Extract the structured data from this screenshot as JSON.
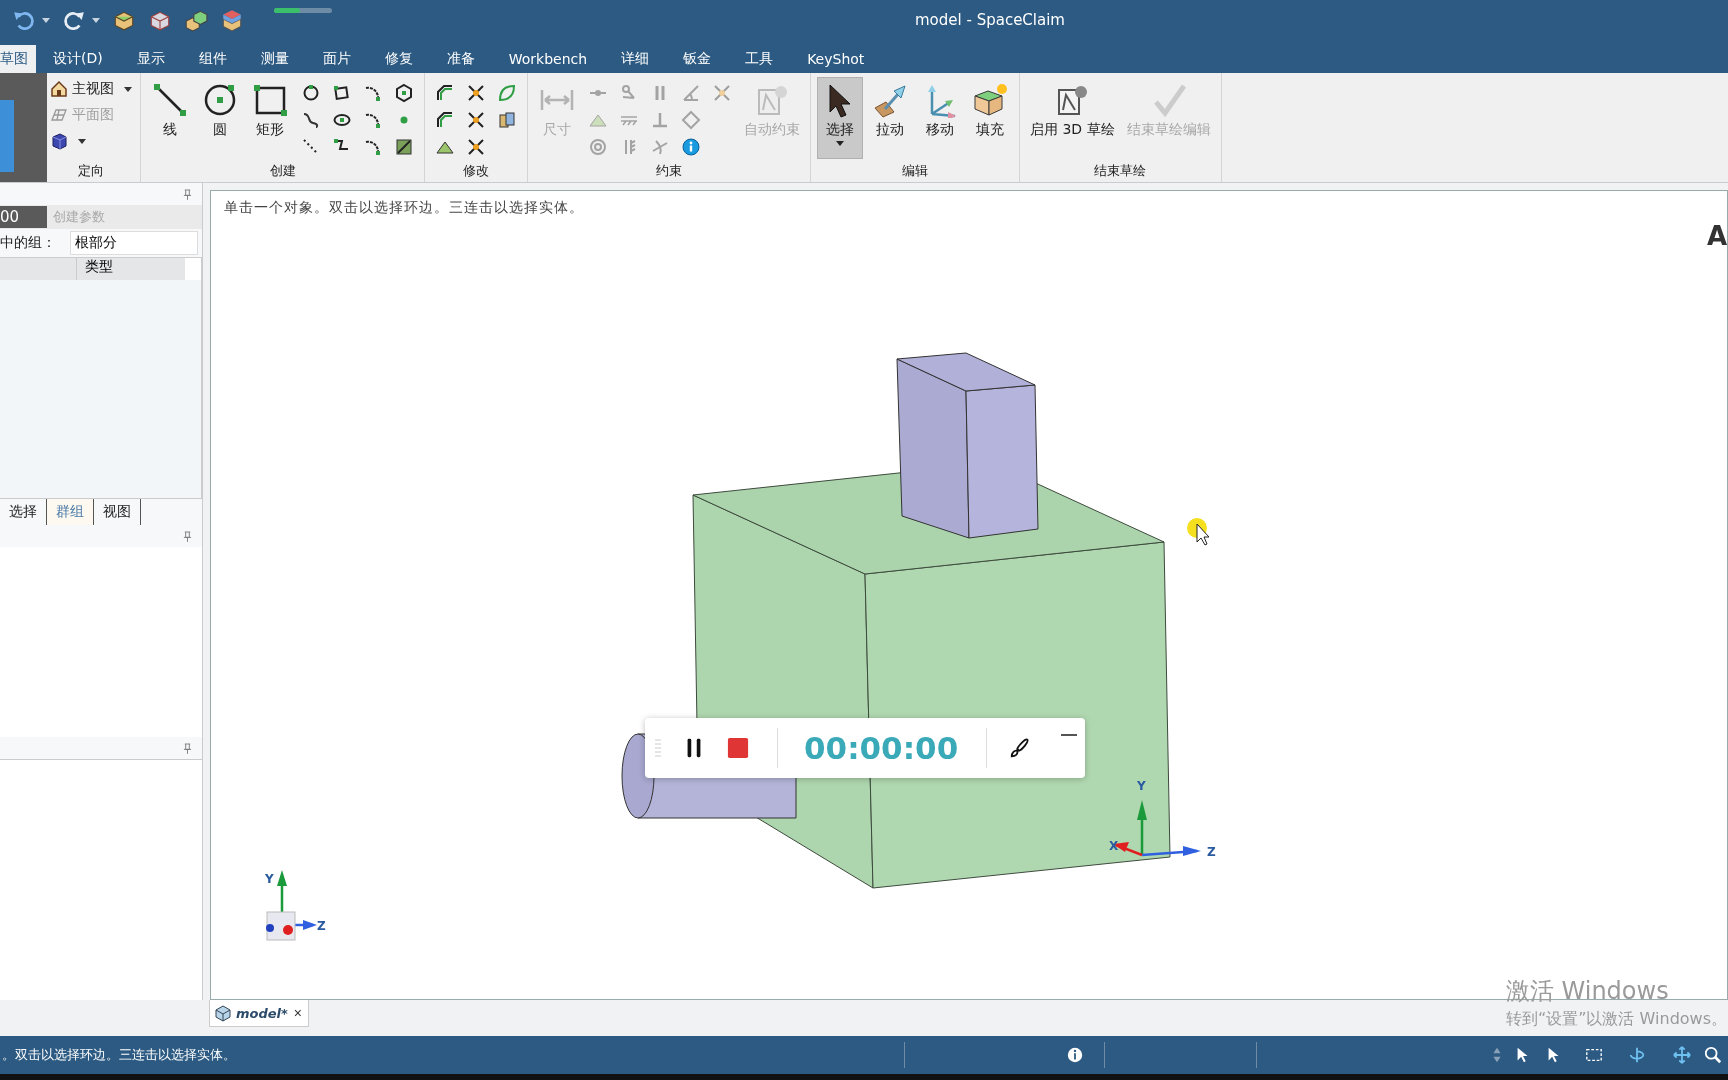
{
  "window": {
    "title": "model - SpaceClaim"
  },
  "quick_access": [
    {
      "kind": "undo",
      "dropdown": true
    },
    {
      "kind": "redo",
      "dropdown": true
    },
    {
      "kind": "box"
    },
    {
      "kind": "box-frame"
    },
    {
      "kind": "boxes"
    },
    {
      "kind": "stack"
    }
  ],
  "progress": {
    "level": 0.45
  },
  "ribbon_tabs": [
    {
      "label": "草图",
      "selected": true
    },
    {
      "label": "设计(D)",
      "selected": false
    },
    {
      "label": "显示",
      "selected": false
    },
    {
      "label": "组件",
      "selected": false
    },
    {
      "label": "测量",
      "selected": false
    },
    {
      "label": "面片",
      "selected": false
    },
    {
      "label": "修复",
      "selected": false
    },
    {
      "label": "准备",
      "selected": false
    },
    {
      "label": "Workbench",
      "selected": false
    },
    {
      "label": "详细",
      "selected": false
    },
    {
      "label": "钣金",
      "selected": false
    },
    {
      "label": "工具",
      "selected": false
    },
    {
      "label": "KeyShot",
      "selected": false
    }
  ],
  "ribbon_groups": [
    {
      "label": "定向",
      "rows": [
        {
          "kind": "home",
          "label": "主视图",
          "dropdown": true,
          "disabled": false
        },
        {
          "kind": "grid",
          "label": "平面图",
          "disabled": true
        },
        {
          "kind": "cube",
          "dropdown": true,
          "disabled": false
        }
      ]
    },
    {
      "label": "创建",
      "large": [
        {
          "kind": "line",
          "label": "线",
          "disabled": false,
          "selected": false
        },
        {
          "kind": "circle",
          "label": "圆",
          "disabled": false,
          "selected": false
        },
        {
          "kind": "rect",
          "label": "矩形",
          "disabled": false,
          "selected": false
        }
      ],
      "tools": [
        {
          "kind": "ring",
          "disabled": false
        },
        {
          "kind": "curve",
          "disabled": false
        },
        {
          "kind": "dotted",
          "disabled": false
        },
        {
          "kind": "square",
          "disabled": false
        },
        {
          "kind": "ellipse",
          "disabled": false
        },
        {
          "kind": "zigzag",
          "disabled": false
        },
        {
          "kind": "arc",
          "disabled": false
        },
        {
          "kind": "arc",
          "disabled": false
        },
        {
          "kind": "arc",
          "disabled": false
        },
        {
          "kind": "hexagon",
          "disabled": false
        },
        {
          "kind": "dot",
          "disabled": false
        },
        {
          "kind": "pencil",
          "disabled": false
        }
      ]
    },
    {
      "label": "修改",
      "tools": [
        {
          "kind": "corner",
          "disabled": false
        },
        {
          "kind": "corner",
          "disabled": false
        },
        {
          "kind": "triangle",
          "disabled": false
        },
        {
          "kind": "cross",
          "disabled": false
        },
        {
          "kind": "cross",
          "disabled": false
        },
        {
          "kind": "cross",
          "disabled": false
        },
        {
          "kind": "leaf",
          "disabled": false
        },
        {
          "kind": "pages",
          "disabled": false
        }
      ]
    },
    {
      "label": "约束",
      "large": [
        {
          "kind": "dimension",
          "label": "尺寸",
          "disabled": true,
          "selected": false
        }
      ],
      "tools": [
        {
          "kind": "dot-line",
          "disabled": true
        },
        {
          "kind": "triangle",
          "disabled": true
        },
        {
          "kind": "target",
          "disabled": true
        },
        {
          "kind": "anchor",
          "disabled": true
        },
        {
          "kind": "hatch",
          "disabled": true
        },
        {
          "kind": "bars",
          "disabled": true
        },
        {
          "kind": "parallel",
          "disabled": true
        },
        {
          "kind": "perpendicular",
          "disabled": true
        },
        {
          "kind": "tangent",
          "disabled": true
        },
        {
          "kind": "angle",
          "disabled": true
        },
        {
          "kind": "diamond",
          "disabled": true
        },
        {
          "kind": "info",
          "disabled": false
        },
        {
          "kind": "cross",
          "disabled": true
        }
      ],
      "large_end": [
        {
          "kind": "auto",
          "label": "自动约束",
          "disabled": true,
          "selected": false
        }
      ]
    },
    {
      "label": "编辑",
      "large": [
        {
          "kind": "select",
          "label": "选择",
          "disabled": false,
          "selected": true,
          "dropdown": true
        },
        {
          "kind": "pull",
          "label": "拉动",
          "disabled": false,
          "selected": false
        },
        {
          "kind": "move",
          "label": "移动",
          "disabled": false,
          "selected": false
        },
        {
          "kind": "fill",
          "label": "填充",
          "disabled": false,
          "selected": false
        }
      ]
    },
    {
      "label": "结束草绘",
      "large": [
        {
          "kind": "sketch3d",
          "label": "启用 3D 草绘",
          "disabled": false,
          "selected": false
        },
        {
          "kind": "check",
          "label": "结束草绘编辑",
          "disabled": true,
          "selected": false
        }
      ]
    }
  ],
  "recorder_preview": {
    "text": "00"
  },
  "left_panel": {
    "params_label": "创建参数",
    "group_label": "中的组：",
    "group_value": "根部分",
    "table_columns": [
      "类型"
    ],
    "tabs": [
      {
        "label": "选择",
        "selected": false
      },
      {
        "label": "群组",
        "selected": true
      },
      {
        "label": "视图",
        "selected": false
      }
    ]
  },
  "viewport": {
    "hint": "单击一个对象。双击以选择环边。三连击以选择实体。",
    "logo_text": "A",
    "corner_triad": [
      "Y",
      "Z"
    ],
    "model_triad": [
      "Y",
      "X",
      "Z"
    ]
  },
  "recorder": {
    "time": "00:00:00"
  },
  "doc_tabs": [
    {
      "label": "model*",
      "close": "×",
      "selected": true
    }
  ],
  "activation": {
    "title": "激活 Windows",
    "subtitle": "转到“设置”以激活 Windows。"
  },
  "status_bar": {
    "text": "。双击以选择环边。三连击以选择实体。"
  }
}
